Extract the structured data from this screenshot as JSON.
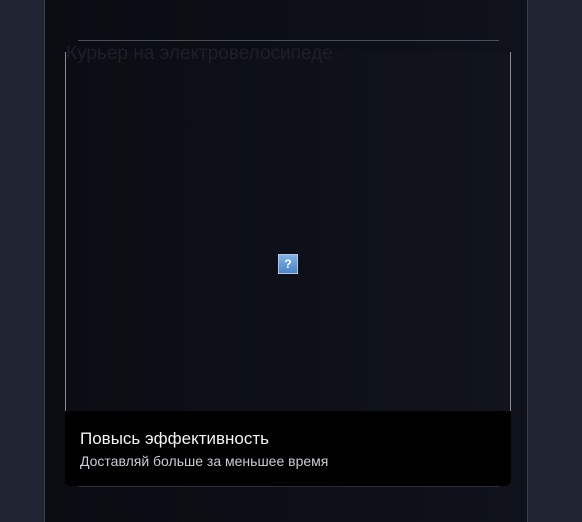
{
  "card": {
    "image_alt": "Курьер на электровелосипеде",
    "image_icon": "broken-image-icon",
    "caption_title": "Повысь эффективность",
    "caption_subtitle": "Доставляй больше за меньшее время"
  },
  "colors": {
    "background": "#1f2332",
    "panel": "#0c0e15",
    "caption_background": "#000000",
    "caption_title": "#f2f3f5",
    "caption_subtitle": "#c9ccd3"
  }
}
